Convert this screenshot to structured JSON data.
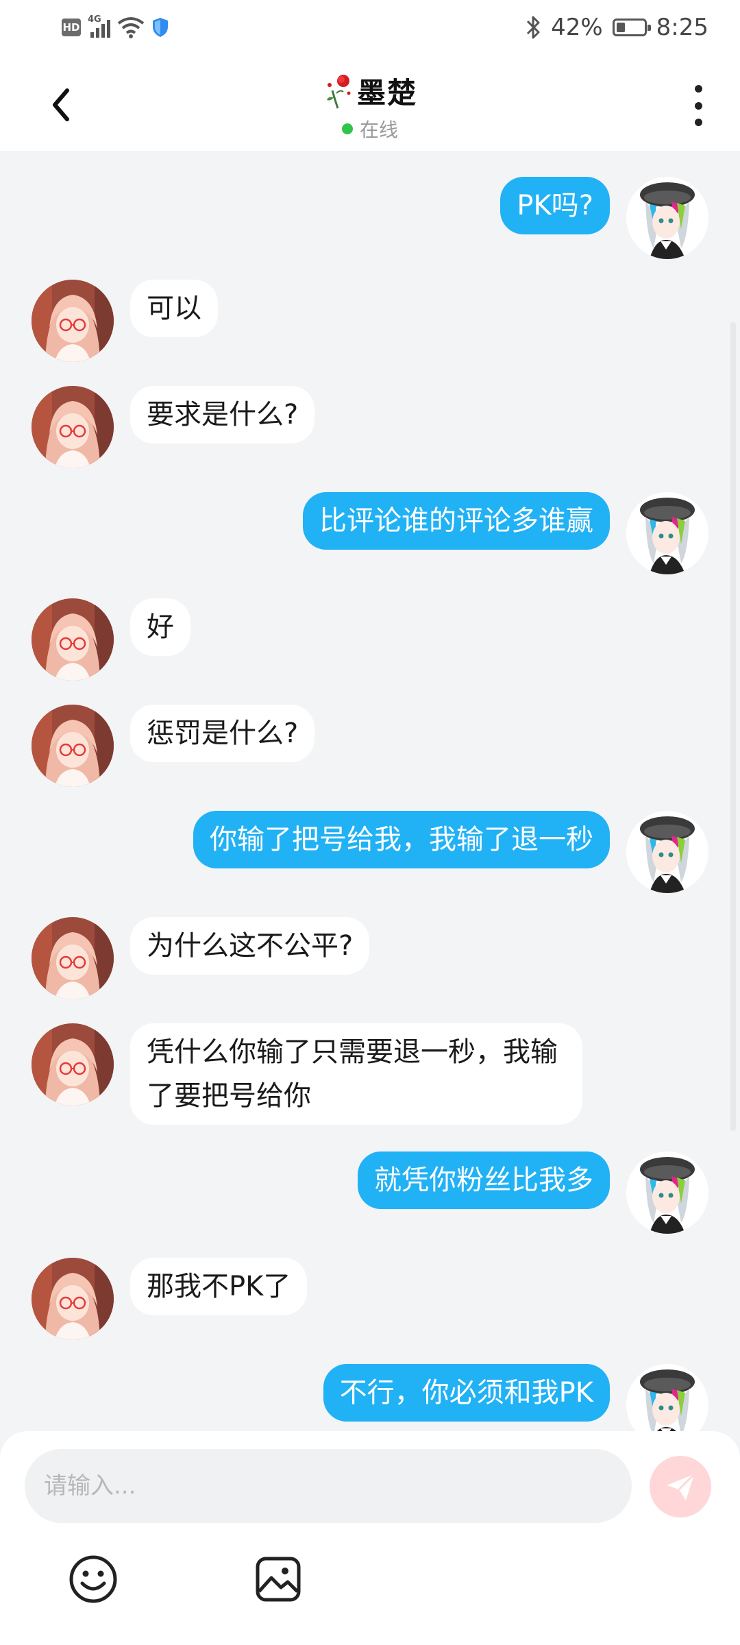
{
  "status_bar": {
    "hd": "HD",
    "network": "4G",
    "battery_percent": "42%",
    "battery_level": 0.42,
    "time": "8:25",
    "icons": [
      "hd-icon",
      "signal-icon",
      "wifi-icon",
      "shield-icon",
      "bluetooth-icon",
      "battery-icon"
    ]
  },
  "header": {
    "title": "墨楚",
    "status": "在线",
    "status_color": "#31c44a",
    "icons": [
      "back-icon",
      "rose-icon",
      "more-icon"
    ]
  },
  "messages": [
    {
      "side": "right",
      "text": "PK吗?"
    },
    {
      "side": "left",
      "text": "可以"
    },
    {
      "side": "left",
      "text": "要求是什么?"
    },
    {
      "side": "right",
      "text": "比评论谁的评论多谁赢"
    },
    {
      "side": "left",
      "text": "好"
    },
    {
      "side": "left",
      "text": "惩罚是什么?"
    },
    {
      "side": "right",
      "text": "你输了把号给我，我输了退一秒"
    },
    {
      "side": "left",
      "text": "为什么这不公平?"
    },
    {
      "side": "left",
      "text": "凭什么你输了只需要退一秒，我输了要把号给你"
    },
    {
      "side": "right",
      "text": "就凭你粉丝比我多"
    },
    {
      "side": "left",
      "text": "那我不PK了"
    },
    {
      "side": "right",
      "text": "不行，你必须和我PK"
    }
  ],
  "input": {
    "placeholder": "请输入...",
    "value": ""
  },
  "toolbar": {
    "icons": [
      "emoji-icon",
      "image-icon",
      "send-icon"
    ]
  },
  "colors": {
    "outgoing_bubble": "#21b1f5",
    "incoming_bubble": "#ffffff",
    "background": "#f3f4f6",
    "send_button": "#ffd7d8"
  }
}
